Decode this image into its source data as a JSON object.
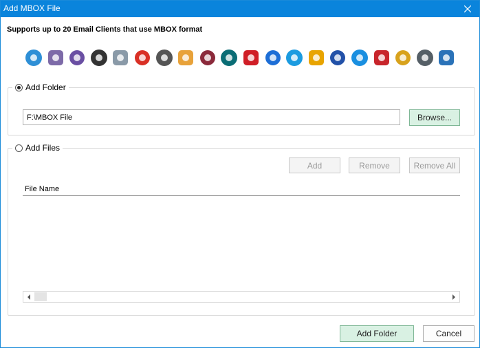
{
  "window": {
    "title": "Add MBOX File"
  },
  "header": {
    "subtitle": "Supports up to 20 Email Clients that use MBOX format"
  },
  "clients": [
    {
      "icon": "mail-window-icon",
      "color": "#2e8fd6"
    },
    {
      "icon": "postbox-icon",
      "color": "#7d6aa8"
    },
    {
      "icon": "e-client-icon",
      "color": "#6a4fa3"
    },
    {
      "icon": "eudora-icon",
      "color": "#333333"
    },
    {
      "icon": "cloud-clock-icon",
      "color": "#8a9aa8"
    },
    {
      "icon": "gmail-icon",
      "color": "#d93025"
    },
    {
      "icon": "gnu-icon",
      "color": "#555555"
    },
    {
      "icon": "g-mail-icon",
      "color": "#e8a23a"
    },
    {
      "icon": "grapes-icon",
      "color": "#8b2a3b"
    },
    {
      "icon": "netscape-icon",
      "color": "#0a6d75"
    },
    {
      "icon": "opera-icon",
      "color": "#d01e26"
    },
    {
      "icon": "mail-plus-icon",
      "color": "#1d6ed6"
    },
    {
      "icon": "blue-book-icon",
      "color": "#1b9be0"
    },
    {
      "icon": "at-sign-icon",
      "color": "#e8a400"
    },
    {
      "icon": "x-mail-icon",
      "color": "#2251a8"
    },
    {
      "icon": "paper-plane-icon",
      "color": "#1a8fe0"
    },
    {
      "icon": "red-arrow-icon",
      "color": "#c8252b"
    },
    {
      "icon": "bat-icon",
      "color": "#d8a21c"
    },
    {
      "icon": "seamonkey-icon",
      "color": "#555f66"
    },
    {
      "icon": "thunderbird-icon",
      "color": "#2a72b8"
    }
  ],
  "add_folder": {
    "label": "Add Folder",
    "selected": true,
    "path_value": "F:\\MBOX File",
    "browse_label": "Browse..."
  },
  "add_files": {
    "label": "Add Files",
    "selected": false,
    "add_label": "Add",
    "remove_label": "Remove",
    "remove_all_label": "Remove All",
    "column_header": "File Name"
  },
  "footer": {
    "add_folder_label": "Add Folder",
    "cancel_label": "Cancel"
  }
}
